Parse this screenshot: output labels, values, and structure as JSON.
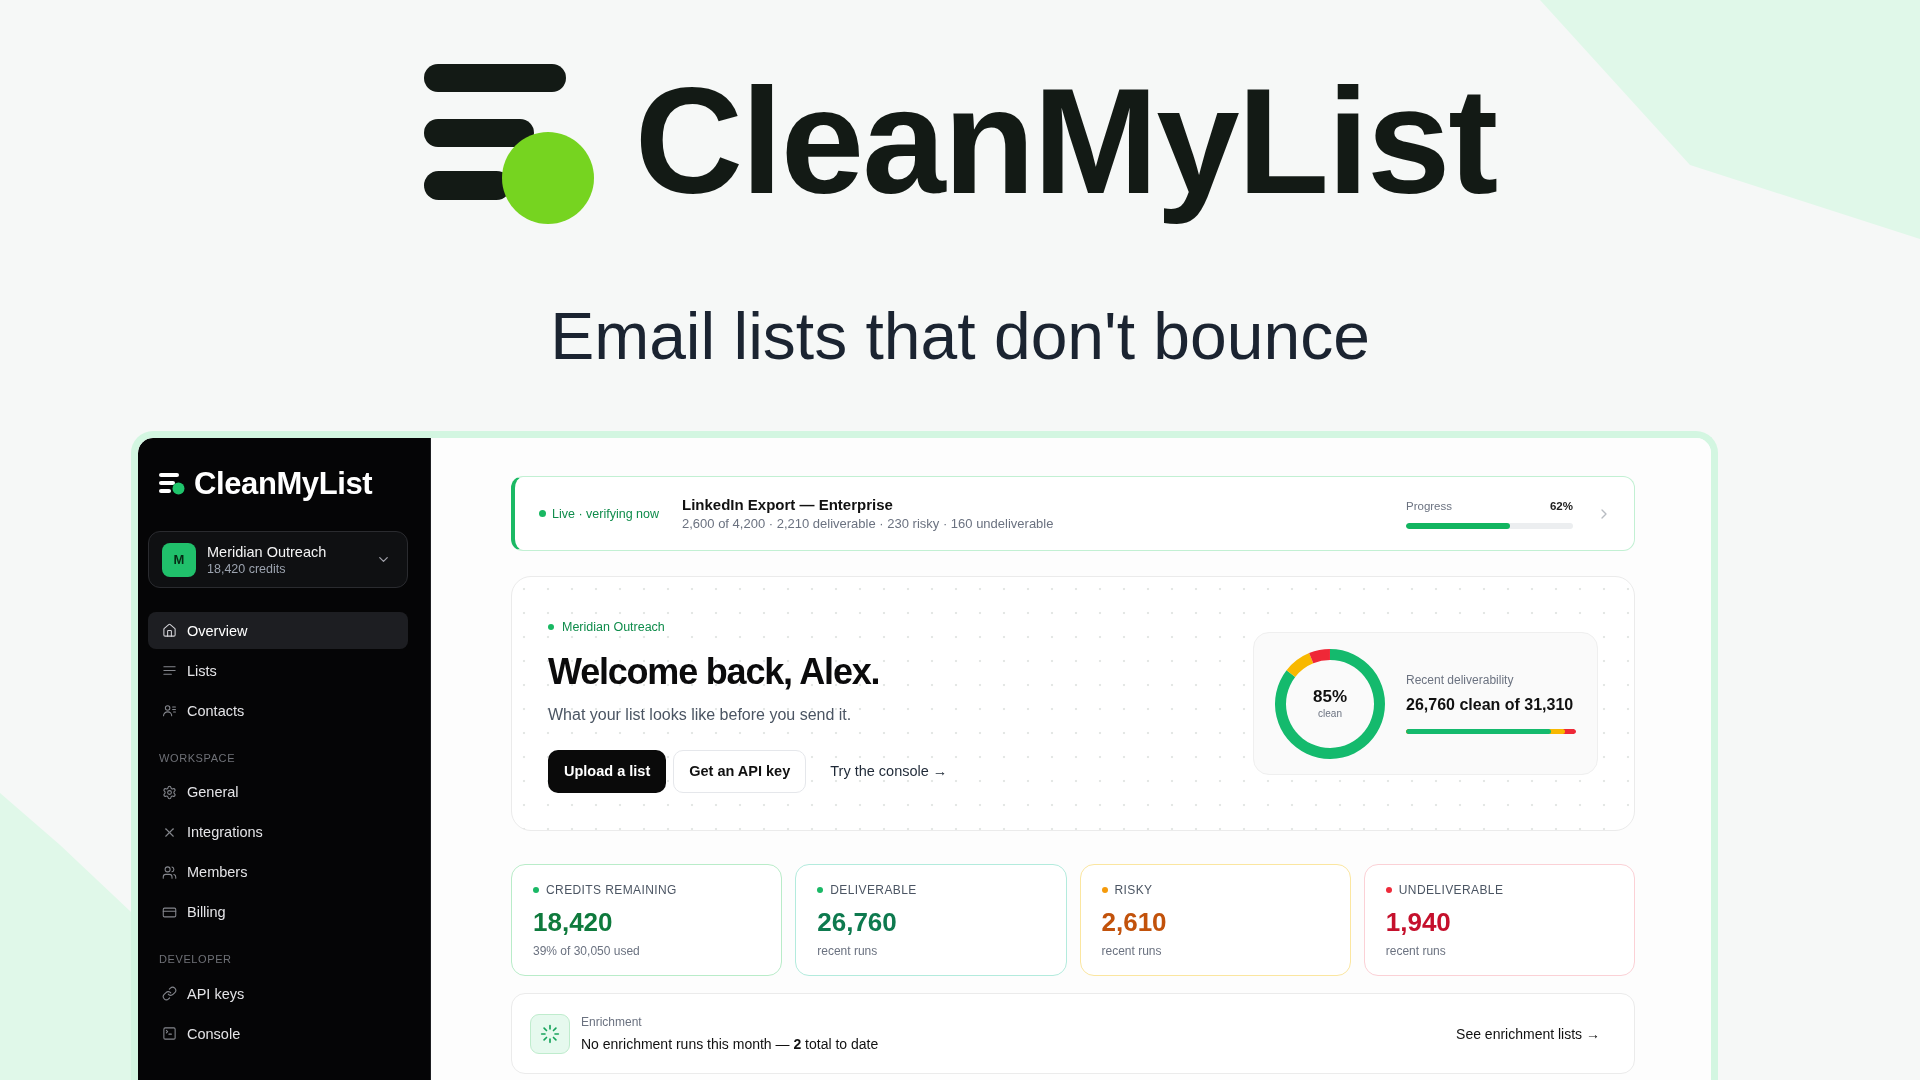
{
  "hero": {
    "brand": "CleanMyList",
    "tagline": "Email lists that don't bounce"
  },
  "sidebar": {
    "brand": "CleanMyList",
    "account": {
      "initial": "M",
      "name": "Meridian Outreach",
      "credits": "18,420 credits"
    },
    "sections": [
      {
        "items": [
          {
            "kind": "overview",
            "label": "Overview",
            "selected": true
          },
          {
            "kind": "lists",
            "label": "Lists",
            "selected": false
          },
          {
            "kind": "contacts",
            "label": "Contacts",
            "selected": false
          }
        ]
      },
      {
        "title": "WORKSPACE",
        "items": [
          {
            "kind": "general",
            "label": "General",
            "selected": false
          },
          {
            "kind": "integrations",
            "label": "Integrations",
            "selected": false
          },
          {
            "kind": "members",
            "label": "Members",
            "selected": false
          },
          {
            "kind": "billing",
            "label": "Billing",
            "selected": false
          }
        ]
      },
      {
        "title": "DEVELOPER",
        "items": [
          {
            "kind": "keys",
            "label": "API keys",
            "selected": false
          },
          {
            "kind": "console",
            "label": "Console",
            "selected": false
          }
        ]
      }
    ]
  },
  "live_banner": {
    "status": "Live · verifying now",
    "title": "LinkedIn Export — Enterprise",
    "summary": "2,600 of 4,200 · 2,210 deliverable · 230 risky · 160 undeliverable",
    "progress_label": "Progress",
    "reading": "62%",
    "level": 0.62
  },
  "welcome": {
    "workspace": "Meridian Outreach",
    "heading": "Welcome back, Alex.",
    "subtitle": "What your list looks like before you send it.",
    "actions": [
      {
        "kind": "primary",
        "label": "Upload a list"
      },
      {
        "kind": "secondary",
        "label": "Get an API key"
      },
      {
        "kind": "link",
        "label": "Try the console →"
      }
    ],
    "deliverability": {
      "percent": "85%",
      "percent_caption": "clean",
      "label": "Recent deliverability",
      "summary": "26,760 clean of 31,310",
      "layers": [
        {
          "level": 0.855,
          "color": "#14ba6d"
        },
        {
          "level": 0.938,
          "color": "#f8b800"
        },
        {
          "level": 1.0,
          "color": "#ef2837"
        }
      ]
    }
  },
  "stats": [
    {
      "kind": "credits",
      "color": "#1ab866",
      "label": "CREDITS REMAINING",
      "value": "18,420",
      "note": "39% of 30,050 used"
    },
    {
      "kind": "deliverable",
      "color": "#1ab866",
      "label": "DELIVERABLE",
      "value": "26,760",
      "note": "recent runs"
    },
    {
      "kind": "risky",
      "color": "#f59a0b",
      "label": "RISKY",
      "value": "2,610",
      "note": "recent runs"
    },
    {
      "kind": "undeliverable",
      "color": "#ee2a3a",
      "label": "UNDELIVERABLE",
      "value": "1,940",
      "note": "recent runs"
    }
  ],
  "enrichment": {
    "title": "Enrichment",
    "message": "No enrichment runs this month — **2** total to date",
    "link": "See enrichment lists →"
  }
}
